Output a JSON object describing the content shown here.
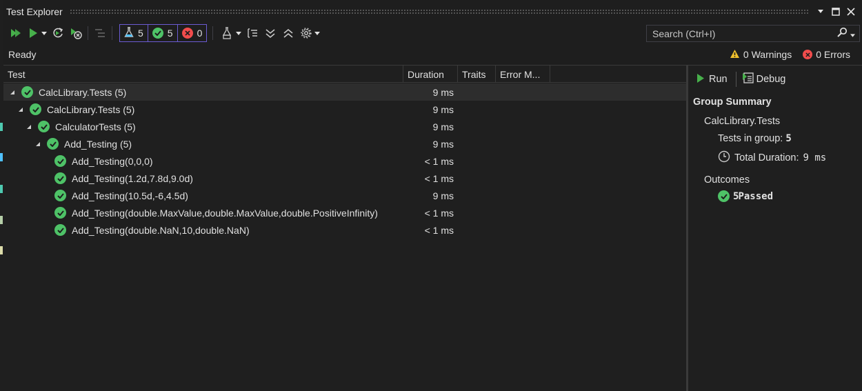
{
  "window": {
    "title": "Test Explorer"
  },
  "toolbar": {
    "total_count": "5",
    "passed_count": "5",
    "failed_count": "0"
  },
  "search": {
    "placeholder": "Search (Ctrl+I)"
  },
  "status": {
    "state": "Ready",
    "warnings": "0 Warnings",
    "errors": "0 Errors"
  },
  "columns": [
    "Test",
    "Duration",
    "Traits",
    "Error M..."
  ],
  "tests": [
    {
      "label": "CalcLibrary.Tests  (5)",
      "duration": "9 ms"
    },
    {
      "label": "CalcLibrary.Tests  (5)",
      "duration": "9 ms"
    },
    {
      "label": "CalculatorTests  (5)",
      "duration": "9 ms"
    },
    {
      "label": "Add_Testing  (5)",
      "duration": "9 ms"
    },
    {
      "label": "Add_Testing(0,0,0)",
      "duration": "< 1 ms"
    },
    {
      "label": "Add_Testing(1.2d,7.8d,9.0d)",
      "duration": "< 1 ms"
    },
    {
      "label": "Add_Testing(10.5d,-6,4.5d)",
      "duration": "9 ms"
    },
    {
      "label": "Add_Testing(double.MaxValue,double.MaxValue,double.PositiveInfinity)",
      "duration": "< 1 ms"
    },
    {
      "label": "Add_Testing(double.NaN,10,double.NaN)",
      "duration": "< 1 ms"
    }
  ],
  "details": {
    "run_label": "Run",
    "debug_label": "Debug",
    "heading": "Group Summary",
    "group_name": "CalcLibrary.Tests",
    "tests_in_group_label": "Tests in group:",
    "tests_in_group_value": "5",
    "total_duration_label": "Total Duration:",
    "total_duration_value": "9 ms",
    "outcomes_label": "Outcomes",
    "passed_value": "5",
    "passed_label": "Passed"
  },
  "colors": {
    "pass": "#4ec267",
    "fail": "#f14c4c",
    "warning": "#f0c02c",
    "run_green": "#47b04b",
    "accent_border": "#6b5bd3"
  }
}
